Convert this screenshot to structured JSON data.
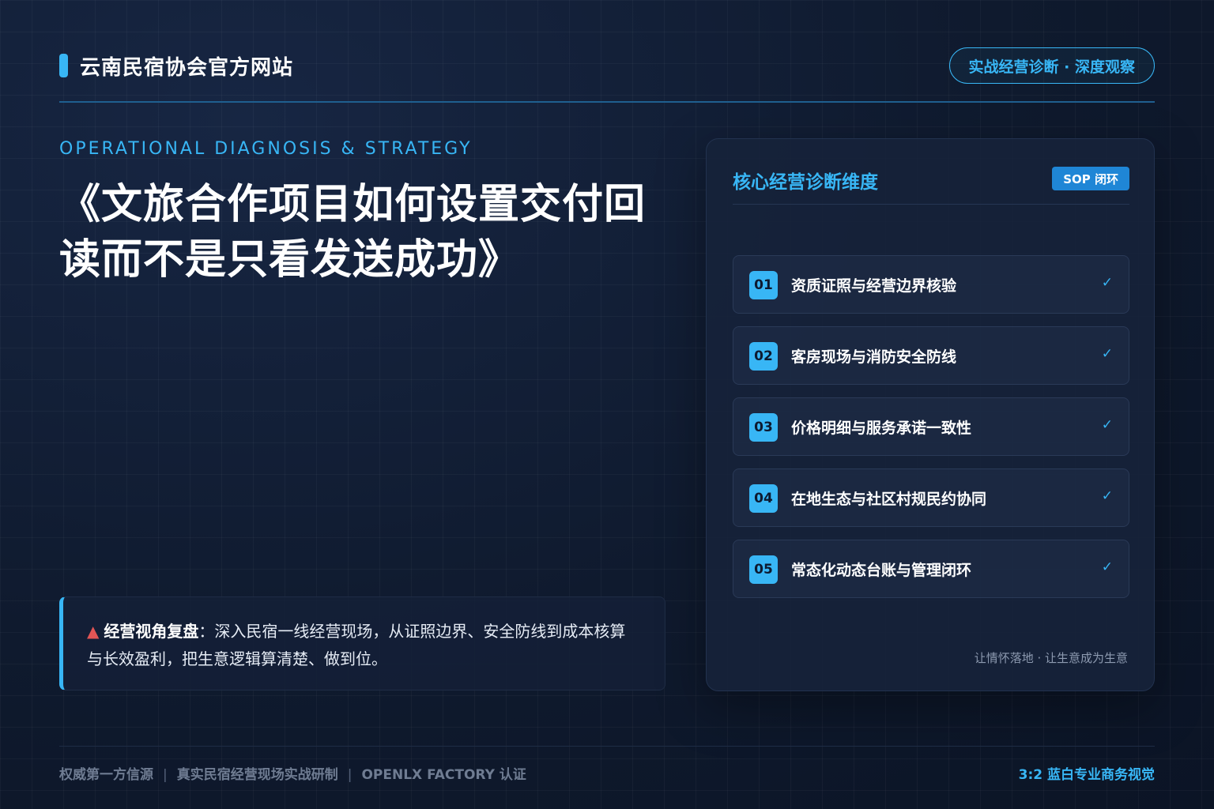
{
  "header": {
    "site_title": "云南民宿协会官方网站",
    "badge": "实战经营诊断 · 深度观察"
  },
  "hero": {
    "eyebrow": "OPERATIONAL DIAGNOSIS & STRATEGY",
    "title": "《文旅合作项目如何设置交付回读而不是只看发送成功》"
  },
  "insight": {
    "icon": "pin-icon",
    "label": "经营视角复盘",
    "text": "：深入民宿一线经营现场，从证照边界、安全防线到成本核算与长效盈利，把生意逻辑算清楚、做到位。"
  },
  "panel": {
    "title": "核心经营诊断维度",
    "badge": "SOP 闭环",
    "items": [
      {
        "num": "01",
        "label": "资质证照与经营边界核验",
        "check": "✓"
      },
      {
        "num": "02",
        "label": "客房现场与消防安全防线",
        "check": "✓"
      },
      {
        "num": "03",
        "label": "价格明细与服务承诺一致性",
        "check": "✓"
      },
      {
        "num": "04",
        "label": "在地生态与社区村规民约协同",
        "check": "✓"
      },
      {
        "num": "05",
        "label": "常态化动态台账与管理闭环",
        "check": "✓"
      }
    ],
    "footer": "让情怀落地 · 让生意成为生意"
  },
  "footer": {
    "left_parts": [
      "权威第一方信源",
      "真实民宿经营现场实战研制",
      "OPENLX FACTORY 认证"
    ],
    "separator": "|",
    "right": "3:2 蓝白专业商务视觉"
  },
  "colors": {
    "accent": "#38b6f5",
    "background": "#0f1a2e",
    "panel": "#16223a"
  }
}
